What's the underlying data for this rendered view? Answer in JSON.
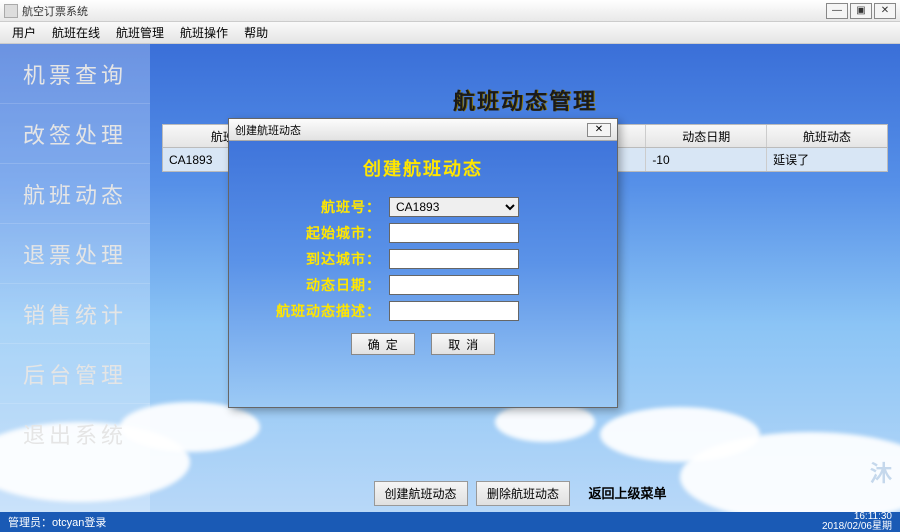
{
  "window": {
    "title": "航空订票系统"
  },
  "menubar": [
    "用户",
    "航班在线",
    "航班管理",
    "航班操作",
    "帮助"
  ],
  "sidebar": {
    "items": [
      {
        "label": "机票查询"
      },
      {
        "label": "改签处理"
      },
      {
        "label": "航班动态"
      },
      {
        "label": "退票处理"
      },
      {
        "label": "销售统计"
      },
      {
        "label": "后台管理"
      },
      {
        "label": "退出系统"
      }
    ]
  },
  "content": {
    "title": "航班动态管理",
    "columns": [
      "航班",
      "",
      "",
      "",
      "动态日期",
      "航班动态"
    ],
    "rows": [
      {
        "c0": "CA1893",
        "c1": "",
        "c2": "",
        "c3": "",
        "c4": "-10",
        "c5": "延误了"
      }
    ],
    "btn_create": "创建航班动态",
    "btn_delete": "删除航班动态",
    "btn_back": "返回上级菜单"
  },
  "dialog": {
    "title": "创建航班动态",
    "heading": "创建航班动态",
    "fields": {
      "flight_label": "航班号：",
      "flight_value": "CA1893",
      "origin_label": "起始城市：",
      "dest_label": "到达城市：",
      "date_label": "动态日期：",
      "desc_label": "航班动态描述："
    },
    "btn_ok": "确定",
    "btn_cancel": "取消"
  },
  "statusbar": {
    "left": "管理员：otcyan登录",
    "time": "16:11:30",
    "date": "2018/02/06星期"
  },
  "watermark": "沐"
}
